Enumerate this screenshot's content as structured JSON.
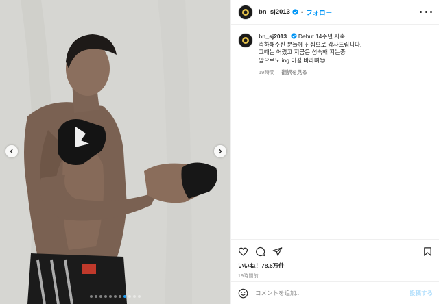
{
  "post": {
    "username": "bn_sj2013",
    "follow_label": "フォロー",
    "verified_icon": "verified-badge-icon",
    "accent_color": "#0095f6"
  },
  "caption": {
    "username": "bn_sj2013",
    "lines": [
      "Debut 14주년 자축",
      "축하해주신 분들께 진심으로 감사드립니다.",
      "그때는 어렸고 지금은 성숙해 지는중",
      "앞으로도 ing 이길 바라며😊"
    ],
    "time": "19時間",
    "translate_label": "翻訳を見る"
  },
  "actions": {
    "likes_label": "いいね！78.6万件",
    "timestamp": "19時間前",
    "icons": [
      "heart-icon",
      "comment-icon",
      "share-icon",
      "bookmark-icon"
    ]
  },
  "comment": {
    "placeholder": "コメントを追加...",
    "post_label": "投稿する"
  },
  "carousel": {
    "total": 11,
    "active_index": 7
  }
}
